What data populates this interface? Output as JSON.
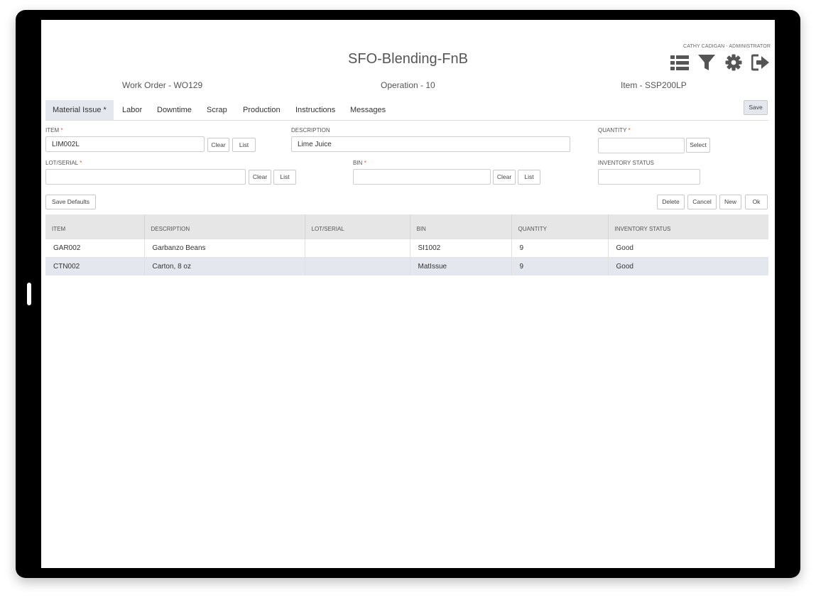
{
  "app": {
    "title": "SFO-Blending-FnB",
    "user": "CATHY CADIGAN - ADMINISTRATOR"
  },
  "meta": {
    "work_order": "Work Order - WO129",
    "operation": "Operation - 10",
    "item": "Item - SSP200LP"
  },
  "icons": {
    "list": "list-icon",
    "filter": "filter-icon",
    "settings": "gear-icon",
    "logout": "logout-icon"
  },
  "tabs": [
    {
      "label": "Material Issue *"
    },
    {
      "label": "Labor"
    },
    {
      "label": "Downtime"
    },
    {
      "label": "Scrap"
    },
    {
      "label": "Production"
    },
    {
      "label": "Instructions"
    },
    {
      "label": "Messages"
    }
  ],
  "buttons": {
    "save": "Save",
    "clear": "Clear",
    "list": "List",
    "select": "Select",
    "save_defaults": "Save Defaults",
    "delete": "Delete",
    "cancel": "Cancel",
    "new": "New",
    "ok": "Ok"
  },
  "form": {
    "item": {
      "label": "ITEM",
      "value": "LIM002L"
    },
    "description": {
      "label": "DESCRIPTION",
      "value": "Lime Juice"
    },
    "quantity": {
      "label": "QUANTITY",
      "value": ""
    },
    "lot_serial": {
      "label": "LOT/SERIAL",
      "value": ""
    },
    "bin": {
      "label": "BIN",
      "value": ""
    },
    "inventory_status": {
      "label": "INVENTORY STATUS",
      "value": ""
    },
    "required_mark": "*"
  },
  "table": {
    "columns": [
      "ITEM",
      "DESCRIPTION",
      "LOT/SERIAL",
      "BIN",
      "QUANTITY",
      "INVENTORY STATUS"
    ],
    "rows": [
      [
        "GAR002",
        "Garbanzo Beans",
        "",
        "SI1002",
        "9",
        "Good"
      ],
      [
        "CTN002",
        "Carton, 8 oz",
        "",
        "MatIssue",
        "9",
        "Good"
      ]
    ]
  },
  "colors": {
    "accent": "#e4e8ee",
    "required": "#e05a2b",
    "header_bg": "#e6e6e6",
    "icon": "#555555"
  }
}
